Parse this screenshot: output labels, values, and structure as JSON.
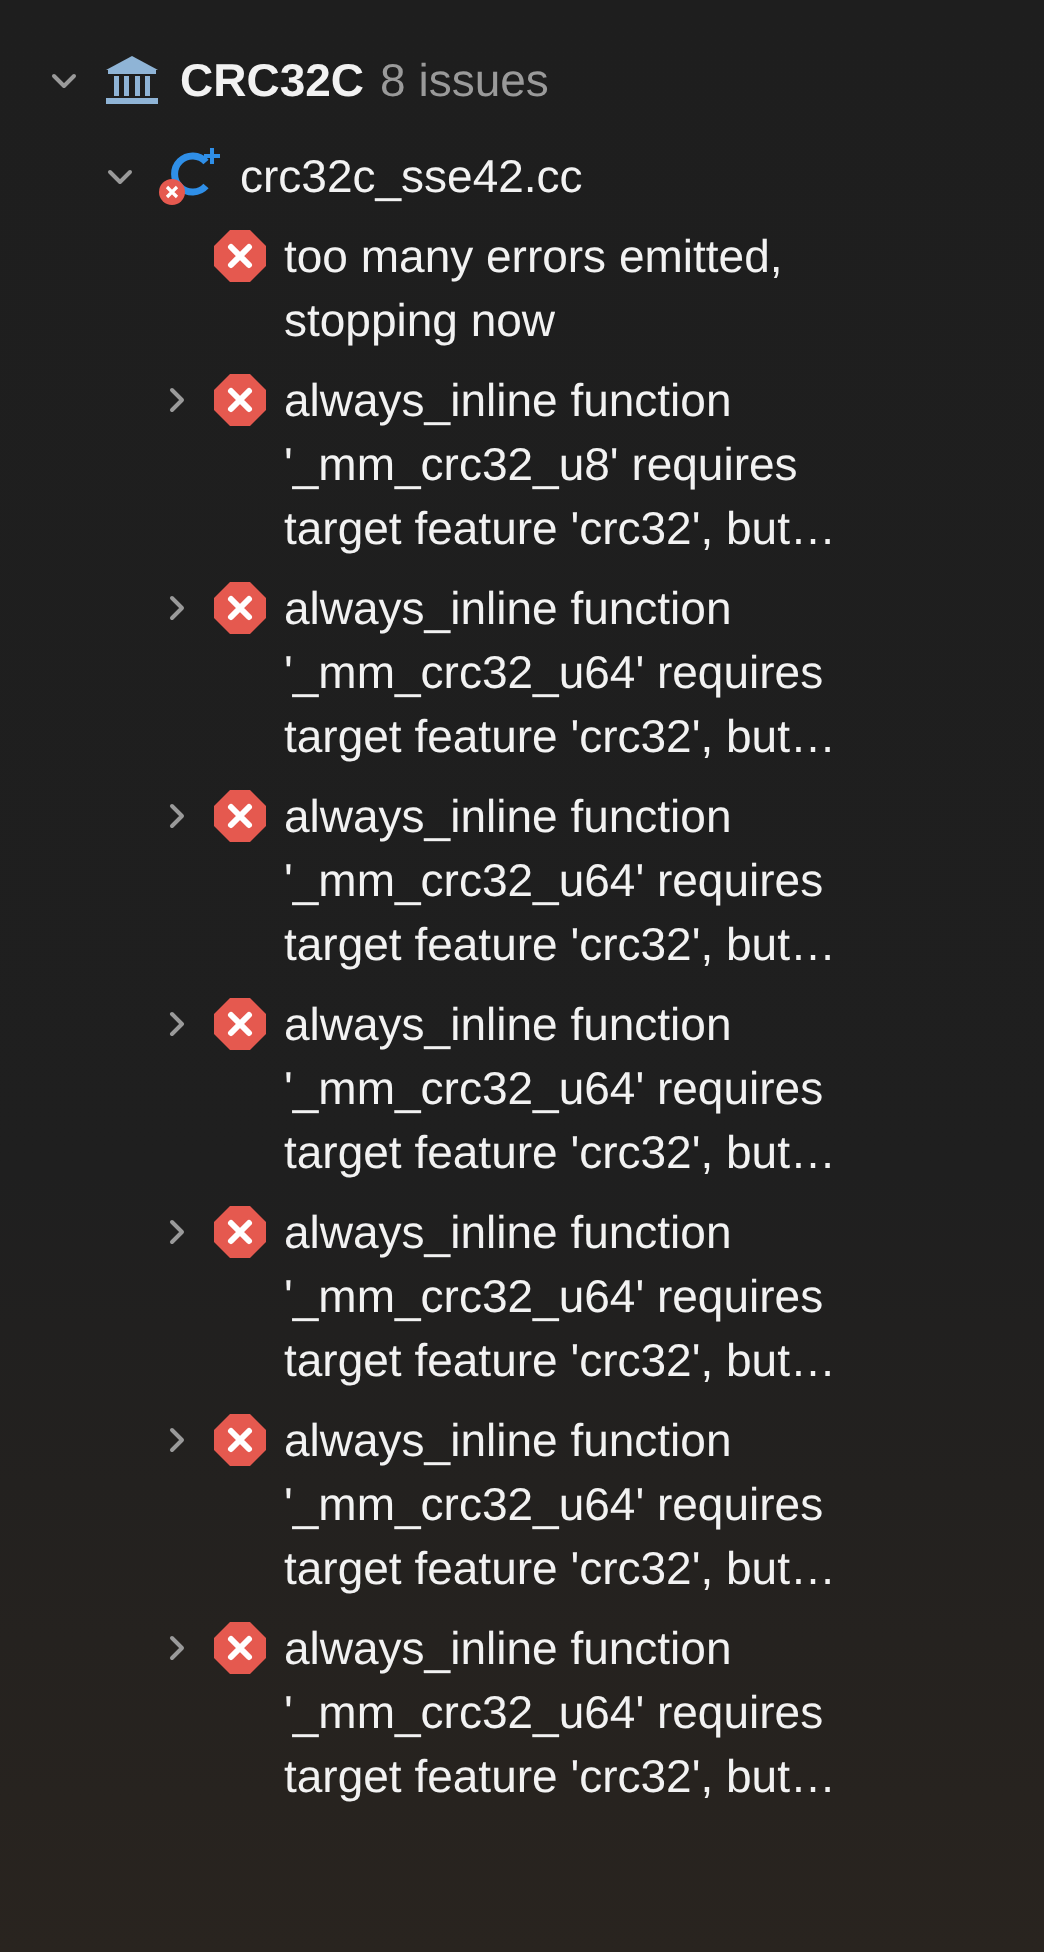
{
  "project": {
    "name": "CRC32C",
    "count": "8 issues",
    "expanded": true,
    "file": {
      "name": "crc32c_sse42.cc",
      "expanded": true,
      "issues": [
        {
          "kind": "leaf",
          "lines": [
            "too many errors emitted,",
            "stopping now"
          ]
        },
        {
          "kind": "group",
          "expanded": false,
          "lines": [
            "always_inline function",
            "'_mm_crc32_u8' requires",
            "target feature 'crc32', but…"
          ]
        },
        {
          "kind": "group",
          "expanded": false,
          "lines": [
            "always_inline function",
            "'_mm_crc32_u64' requires",
            "target feature 'crc32', but…"
          ]
        },
        {
          "kind": "group",
          "expanded": false,
          "lines": [
            "always_inline function",
            "'_mm_crc32_u64' requires",
            "target feature 'crc32', but…"
          ]
        },
        {
          "kind": "group",
          "expanded": false,
          "lines": [
            "always_inline function",
            "'_mm_crc32_u64' requires",
            "target feature 'crc32', but…"
          ]
        },
        {
          "kind": "group",
          "expanded": false,
          "lines": [
            "always_inline function",
            "'_mm_crc32_u64' requires",
            "target feature 'crc32', but…"
          ]
        },
        {
          "kind": "group",
          "expanded": false,
          "lines": [
            "always_inline function",
            "'_mm_crc32_u64' requires",
            "target feature 'crc32', but…"
          ]
        },
        {
          "kind": "group",
          "expanded": false,
          "lines": [
            "always_inline function",
            "'_mm_crc32_u64' requires",
            "target feature 'crc32', but…"
          ]
        }
      ]
    }
  }
}
